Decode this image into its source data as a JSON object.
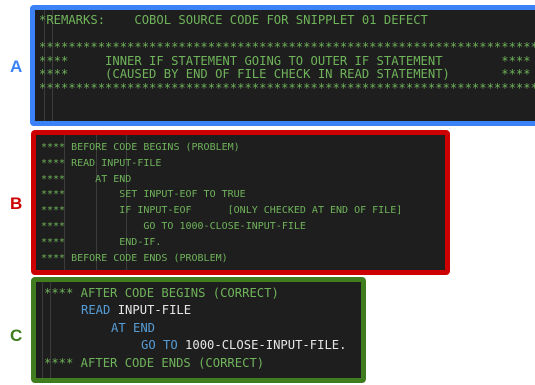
{
  "labels": {
    "a": "A",
    "b": "B",
    "c": "C"
  },
  "colors": {
    "panel_a_border": "#3b82f6",
    "panel_b_border": "#cc0000",
    "panel_c_border": "#3f7d1e",
    "code_bg": "#1e1e1e",
    "comment": "#6fb35a",
    "keyword": "#569cd6",
    "text": "#e6e6e6"
  },
  "panel_a": {
    "lines": [
      "*REMARKS:    COBOL SOURCE CODE FOR SNIPPLET 01 DEFECT",
      "",
      "***********************************************************************",
      "****     INNER IF STATEMENT GOING TO OUTER IF STATEMENT        ****",
      "****     (CAUSED BY END OF FILE CHECK IN READ STATEMENT)       ****",
      "***********************************************************************"
    ]
  },
  "panel_b": {
    "lines": [
      "**** BEFORE CODE BEGINS (PROBLEM)",
      "**** READ INPUT-FILE",
      "****     AT END",
      "****         SET INPUT-EOF TO TRUE",
      "****         IF INPUT-EOF      [ONLY CHECKED AT END OF FILE]",
      "****             GO TO 1000-CLOSE-INPUT-FILE",
      "****         END-IF.",
      "**** BEFORE CODE ENDS (PROBLEM)"
    ]
  },
  "panel_c": {
    "line1": "**** AFTER CODE BEGINS (CORRECT)",
    "read_kw": "READ",
    "read_rest": "INPUT-FILE",
    "at_end_kw": "AT END",
    "goto_kw": "GO TO",
    "goto_rest": "1000-CLOSE-INPUT-FILE.",
    "line5": "**** AFTER CODE ENDS (CORRECT)"
  }
}
